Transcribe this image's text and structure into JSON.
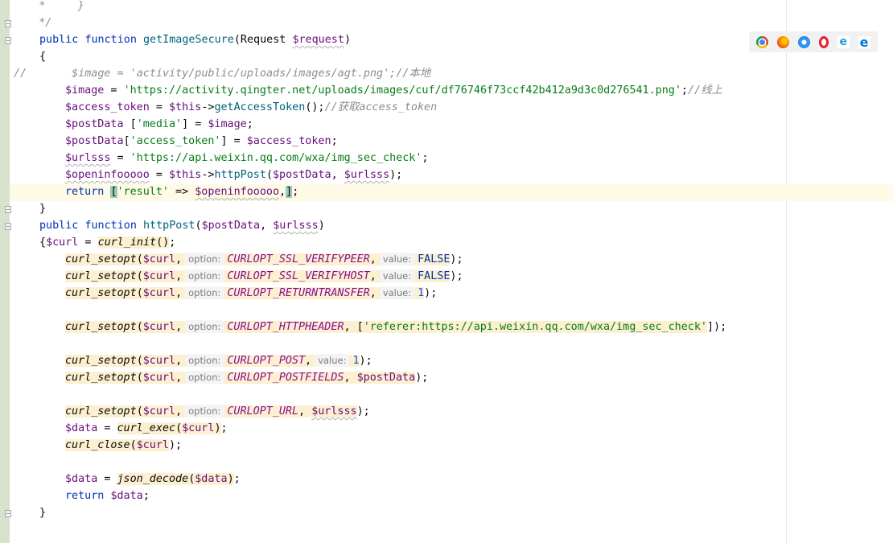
{
  "editor": {
    "lines": {
      "l1_a": "    *     }",
      "l2_a": "    */",
      "l3_kw1": "public",
      "l3_kw2": "function",
      "l3_fn": "getImageSecure",
      "l3_p1": "(Request ",
      "l3_var": "$request",
      "l3_p2": ")",
      "l4_a": "{",
      "l5_a": "//",
      "l5_cmt": "$image = 'activity/public/uploads/images/agt.png';//本地",
      "l6_var": "$image",
      "l6_op": " = ",
      "l6_str": "'https://activity.qingter.net/uploads/images/cuf/df76746f73ccf42b412a9d3c0d276541.png'",
      "l6_semi": ";",
      "l6_cmt": "//线上",
      "l7_var": "$access_token",
      "l7_op": " = ",
      "l7_this": "$this",
      "l7_arrow": "->",
      "l7_fn": "getAccessToken",
      "l7_p": "();",
      "l7_cmt": "//获取access_token",
      "l8_var": "$postData",
      "l8_p1": " [",
      "l8_str": "'media'",
      "l8_p2": "] = ",
      "l8_var2": "$image",
      "l8_p3": ";",
      "l9_var": "$postData",
      "l9_p1": "[",
      "l9_str": "'access_token'",
      "l9_p2": "] = ",
      "l9_var2": "$access_token",
      "l9_p3": ";",
      "l10_var": "$urlsss",
      "l10_op": " = ",
      "l10_str": "'https://api.weixin.qq.com/wxa/img_sec_check'",
      "l10_p": ";",
      "l11_var": "$openinfooooo",
      "l11_op": " = ",
      "l11_this": "$this",
      "l11_arrow": "->",
      "l11_fn": "httpPost",
      "l11_p1": "(",
      "l11_v1": "$postData",
      "l11_p2": ", ",
      "l11_v2": "$urlsss",
      "l11_p3": ");",
      "l12_kw": "return",
      "l12_b1": "[",
      "l12_str": "'result'",
      "l12_op": " => ",
      "l12_var": "$openinfooooo",
      "l12_comma": ",",
      "l12_b2": "]",
      "l12_semi": ";",
      "l13_a": "}",
      "l14_kw1": "public",
      "l14_kw2": "function",
      "l14_fn": "httpPost",
      "l14_p1": "(",
      "l14_v1": "$postData",
      "l14_p2": ", ",
      "l14_v2": "$urlsss",
      "l14_p3": ")",
      "l15_b": "{",
      "l15_var": "$curl",
      "l15_op": " = ",
      "l15_fn": "curl_init",
      "l15_p": "()",
      "l15_semi": ";",
      "l16_fn": "curl_setopt",
      "l16_p1": "(",
      "l16_var": "$curl",
      "l16_c1": ",",
      "l16_h1": "option:",
      "l16_const": "CURLOPT_SSL_VERIFYPEER",
      "l16_c2": ",",
      "l16_h2": "value:",
      "l16_val": "FALSE",
      "l16_p2": ");",
      "l17_fn": "curl_setopt",
      "l17_p1": "(",
      "l17_var": "$curl",
      "l17_c1": ",",
      "l17_h1": "option:",
      "l17_const": "CURLOPT_SSL_VERIFYHOST",
      "l17_c2": ",",
      "l17_h2": "value:",
      "l17_val": "FALSE",
      "l17_p2": ");",
      "l18_fn": "curl_setopt",
      "l18_p1": "(",
      "l18_var": "$curl",
      "l18_c1": ",",
      "l18_h1": "option:",
      "l18_const": "CURLOPT_RETURNTRANSFER",
      "l18_c2": ",",
      "l18_h2": "value:",
      "l18_val": "1",
      "l18_p2": ");",
      "l19_fn": "curl_setopt",
      "l19_p1": "(",
      "l19_var": "$curl",
      "l19_c1": ",",
      "l19_h1": "option:",
      "l19_const": "CURLOPT_HTTPHEADER",
      "l19_c2": ", [",
      "l19_str": "'referer:https://api.weixin.qq.com/wxa/img_sec_check'",
      "l19_p2": "]);",
      "l20_fn": "curl_setopt",
      "l20_p1": "(",
      "l20_var": "$curl",
      "l20_c1": ",",
      "l20_h1": "option:",
      "l20_const": "CURLOPT_POST",
      "l20_c2": ",",
      "l20_h2": "value:",
      "l20_val": "1",
      "l20_p2": ");",
      "l21_fn": "curl_setopt",
      "l21_p1": "(",
      "l21_var": "$curl",
      "l21_c1": ",",
      "l21_h1": "option:",
      "l21_const": "CURLOPT_POSTFIELDS",
      "l21_c2": ", ",
      "l21_var2": "$postData",
      "l21_p2": ");",
      "l22_fn": "curl_setopt",
      "l22_p1": "(",
      "l22_var": "$curl",
      "l22_c1": ",",
      "l22_h1": "option:",
      "l22_const": "CURLOPT_URL",
      "l22_c2": ", ",
      "l22_var2": "$urlsss",
      "l22_p2": ");",
      "l23_var": "$data",
      "l23_op": " = ",
      "l23_fn": "curl_exec",
      "l23_p1": "(",
      "l23_var2": "$curl",
      "l23_p2": ")",
      "l23_semi": ";",
      "l24_fn": "curl_close",
      "l24_p1": "(",
      "l24_var": "$curl",
      "l24_p2": ");",
      "l25_var": "$data",
      "l25_op": " = ",
      "l25_fn": "json_decode",
      "l25_p1": "(",
      "l25_var2": "$data",
      "l25_p2": ")",
      "l25_semi": ";",
      "l26_kw": "return",
      "l26_var": "$data",
      "l26_p": ";",
      "l27_a": "}"
    }
  },
  "browsers": {
    "icons": [
      "chrome-icon",
      "firefox-icon",
      "safari-icon",
      "opera-icon",
      "ie-icon",
      "edge-icon"
    ],
    "ie_glyph": "e",
    "edge_glyph": "e"
  }
}
